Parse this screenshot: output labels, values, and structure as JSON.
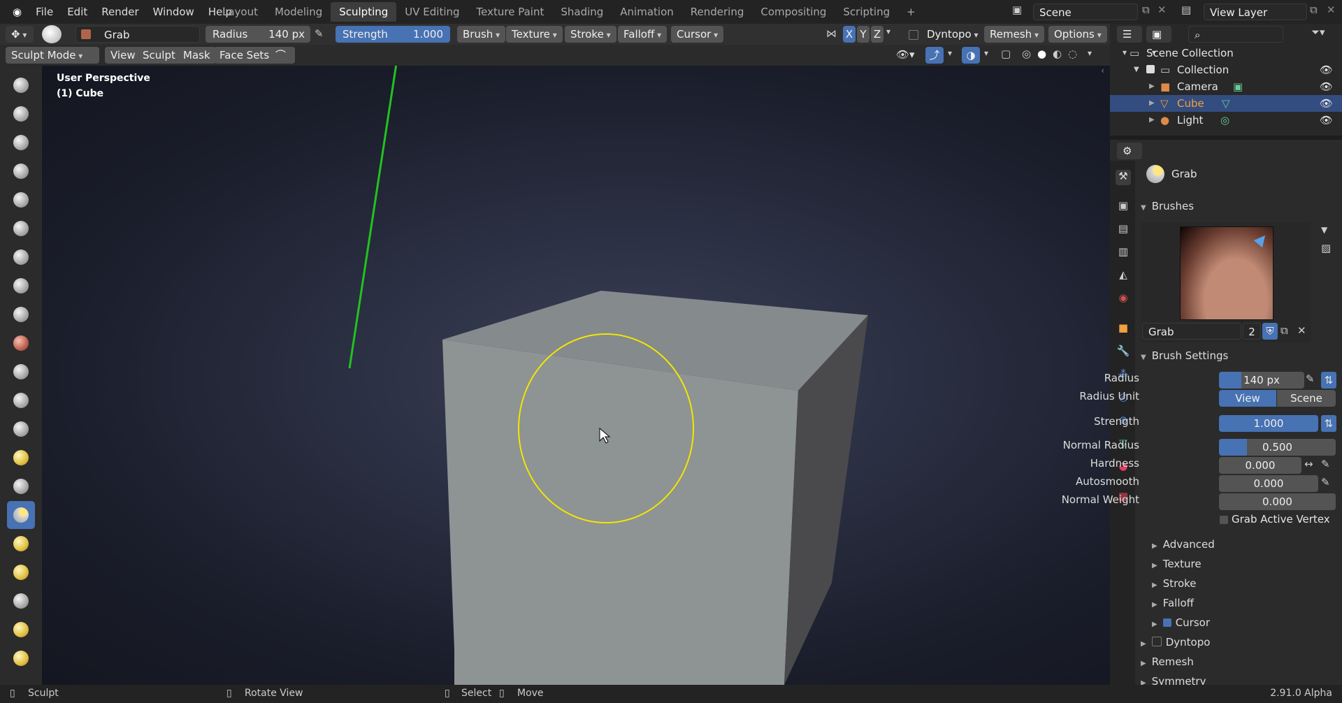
{
  "menu": {
    "file": "File",
    "edit": "Edit",
    "render": "Render",
    "window": "Window",
    "help": "Help"
  },
  "workspaces": [
    "Layout",
    "Modeling",
    "Sculpting",
    "UV Editing",
    "Texture Paint",
    "Shading",
    "Animation",
    "Rendering",
    "Compositing",
    "Scripting"
  ],
  "active_workspace": "Sculpting",
  "scene": {
    "label": "Scene"
  },
  "view_layer": {
    "label": "View Layer"
  },
  "tool_header": {
    "brush_name": "Grab",
    "radius_label": "Radius",
    "radius_value": "140 px",
    "strength_label": "Strength",
    "strength_value": "1.000",
    "brush": "Brush",
    "texture": "Texture",
    "stroke": "Stroke",
    "falloff": "Falloff",
    "cursor": "Cursor",
    "axis_x": "X",
    "axis_y": "Y",
    "axis_z": "Z",
    "dyntopo": "Dyntopo",
    "remesh": "Remesh",
    "options": "Options"
  },
  "mode_header": {
    "mode": "Sculpt Mode",
    "view": "View",
    "sculpt": "Sculpt",
    "mask": "Mask",
    "face_sets": "Face Sets"
  },
  "viewport": {
    "perspective": "User Perspective",
    "object": "(1) Cube"
  },
  "outliner": {
    "root": "Scene Collection",
    "collection": "Collection",
    "items": [
      {
        "name": "Camera"
      },
      {
        "name": "Cube"
      },
      {
        "name": "Light"
      }
    ]
  },
  "properties": {
    "tool_name": "Grab",
    "brushes_header": "Brushes",
    "brush_field": "Grab",
    "brush_users": "2",
    "brush_settings_header": "Brush Settings",
    "radius_label": "Radius",
    "radius_value": "140 px",
    "radius_unit_label": "Radius Unit",
    "unit_view": "View",
    "unit_scene": "Scene",
    "strength_label": "Strength",
    "strength_value": "1.000",
    "normal_radius_label": "Normal Radius",
    "normal_radius_value": "0.500",
    "hardness_label": "Hardness",
    "hardness_value": "0.000",
    "autosmooth_label": "Autosmooth",
    "autosmooth_value": "0.000",
    "normal_weight_label": "Normal Weight",
    "normal_weight_value": "0.000",
    "grab_active_vertex": "Grab Active Vertex",
    "subsections": [
      "Advanced",
      "Texture",
      "Stroke",
      "Falloff",
      "Cursor"
    ],
    "dyntopo": "Dyntopo",
    "remesh": "Remesh",
    "symmetry": "Symmetry"
  },
  "statusbar": {
    "sculpt": "Sculpt",
    "rotate": "Rotate View",
    "select": "Select",
    "move": "Move",
    "version": "2.91.0 Alpha"
  },
  "colors": {
    "accent": "#4772b3",
    "brush_circle": "#f2e600",
    "arrow": "#22c21f"
  }
}
